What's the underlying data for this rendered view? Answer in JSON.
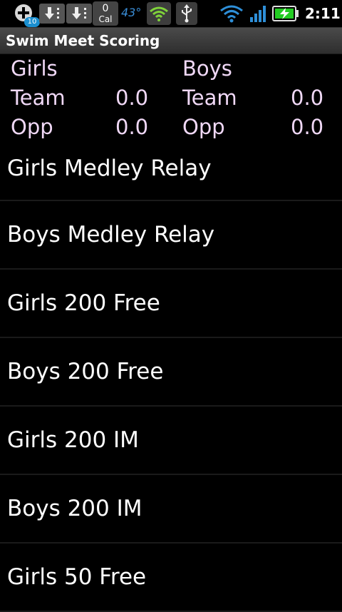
{
  "status_bar": {
    "notification_count": "10",
    "calendar_count": "0",
    "calendar_label": "Cal",
    "temperature": "43°",
    "time": "2:11",
    "icons": [
      "add-icon",
      "download-icon",
      "download-icon",
      "calendar-icon",
      "secure-shield-icon",
      "usb-icon",
      "wifi-icon",
      "signal-icon",
      "battery-charging-icon"
    ],
    "colors": {
      "temperature": "#3a8ed8",
      "badge": "#1a8fd0",
      "battery": "#22cc22"
    }
  },
  "app": {
    "title": "Swim Meet Scoring"
  },
  "scoreboard": {
    "girls": {
      "heading": "Girls",
      "team_label": "Team",
      "team_score": "0.0",
      "opp_label": "Opp",
      "opp_score": "0.0"
    },
    "boys": {
      "heading": "Boys",
      "team_label": "Team",
      "team_score": "0.0",
      "opp_label": "Opp",
      "opp_score": "0.0"
    },
    "text_color": "#f0d8f6"
  },
  "events": [
    {
      "label": "Girls Medley Relay"
    },
    {
      "label": "Boys Medley Relay"
    },
    {
      "label": "Girls 200 Free"
    },
    {
      "label": "Boys 200 Free"
    },
    {
      "label": "Girls 200 IM"
    },
    {
      "label": "Boys 200 IM"
    },
    {
      "label": "Girls 50 Free"
    }
  ]
}
